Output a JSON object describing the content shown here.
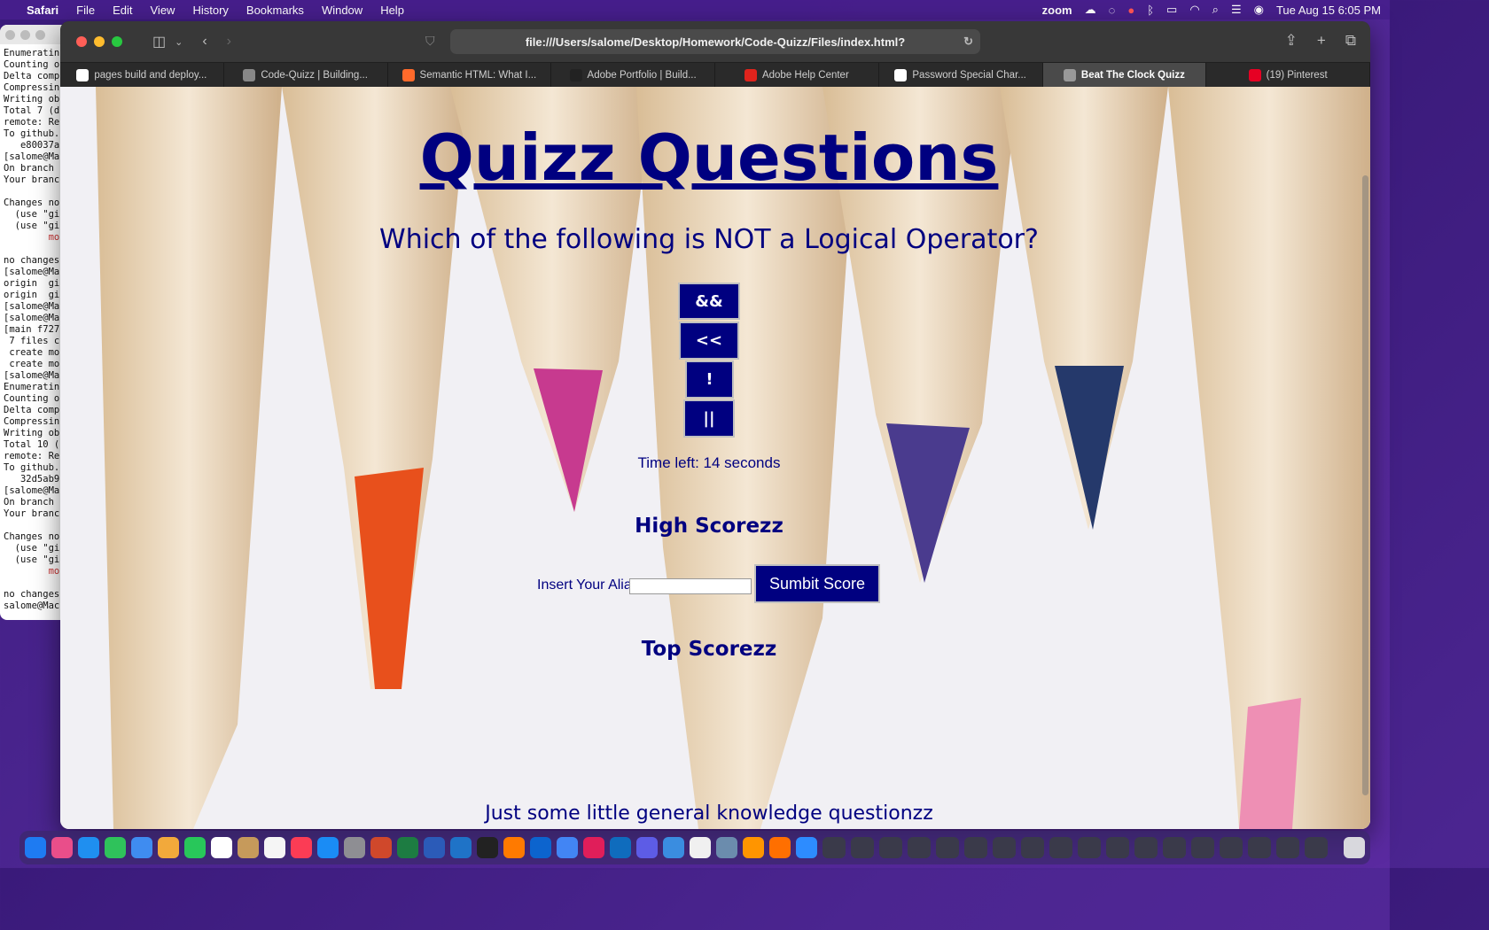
{
  "menubar": {
    "app": "Safari",
    "items": [
      "File",
      "Edit",
      "View",
      "History",
      "Bookmarks",
      "Window",
      "Help"
    ],
    "zoom": "zoom",
    "datetime": "Tue Aug 15  6:05 PM"
  },
  "terminal": {
    "lines": [
      "Enumeratin",
      "Counting o",
      "Delta comp",
      "Compressin",
      "Writing ob",
      "Total 7 (d",
      "remote: Re",
      "To github.",
      "   e80037a",
      "[salome@Mac",
      "On branch",
      "Your branc",
      "",
      "Changes no",
      "  (use \"gi",
      "  (use \"gi",
      "        mo",
      "",
      "no changes",
      "[salome@Mac",
      "origin  gi",
      "origin  gi",
      "[salome@Mac",
      "[salome@Mac",
      "[main f727",
      " 7 files c",
      " create mo",
      " create mo",
      "[salome@Mac",
      "Enumeratin",
      "Counting o",
      "Delta comp",
      "Compressin",
      "Writing ob",
      "Total 10 (",
      "remote: Re",
      "To github.",
      "   32d5ab9",
      "[salome@Mac",
      "On branch",
      "Your branc",
      "",
      "Changes no",
      "  (use \"gi",
      "  (use \"gi",
      "        mo",
      "",
      "no changes",
      "salome@Mac"
    ]
  },
  "browser": {
    "url": "file:///Users/salome/Desktop/Homework/Code-Quizz/Files/index.html?",
    "tabs": [
      {
        "label": "pages build and deploy...",
        "icon": "github-icon",
        "color": "#ffffff"
      },
      {
        "label": "Code-Quizz | Building...",
        "icon": "s-icon",
        "color": "#888888"
      },
      {
        "label": "Semantic HTML: What I...",
        "icon": "codecademy-icon",
        "color": "#ff6a2b"
      },
      {
        "label": "Adobe Portfolio | Build...",
        "icon": "pf-icon",
        "color": "#222222"
      },
      {
        "label": "Adobe Help Center",
        "icon": "adobe-icon",
        "color": "#e0231c"
      },
      {
        "label": "Password Special Char...",
        "icon": "owasp-icon",
        "color": "#ffffff"
      },
      {
        "label": "Beat The Clock Quizz",
        "icon": "compass-icon",
        "color": "#999999",
        "active": true
      },
      {
        "label": "(19) Pinterest",
        "icon": "pinterest-icon",
        "color": "#e60023"
      }
    ]
  },
  "page": {
    "title": "Quizz Questions",
    "question": "Which of the following is NOT a Logical Operator?",
    "answers": [
      "&&",
      "<<",
      "!",
      "||"
    ],
    "timer": "Time left: 14 seconds",
    "high_scores_heading": "High Scorezz",
    "alias_label": "Insert Your Alias",
    "alias_value": "",
    "submit_label": "Sumbit Score",
    "top_scores_heading": "Top Scorezz",
    "footer": "Just some little general knowledge questionzz",
    "text_color": "#000080"
  }
}
